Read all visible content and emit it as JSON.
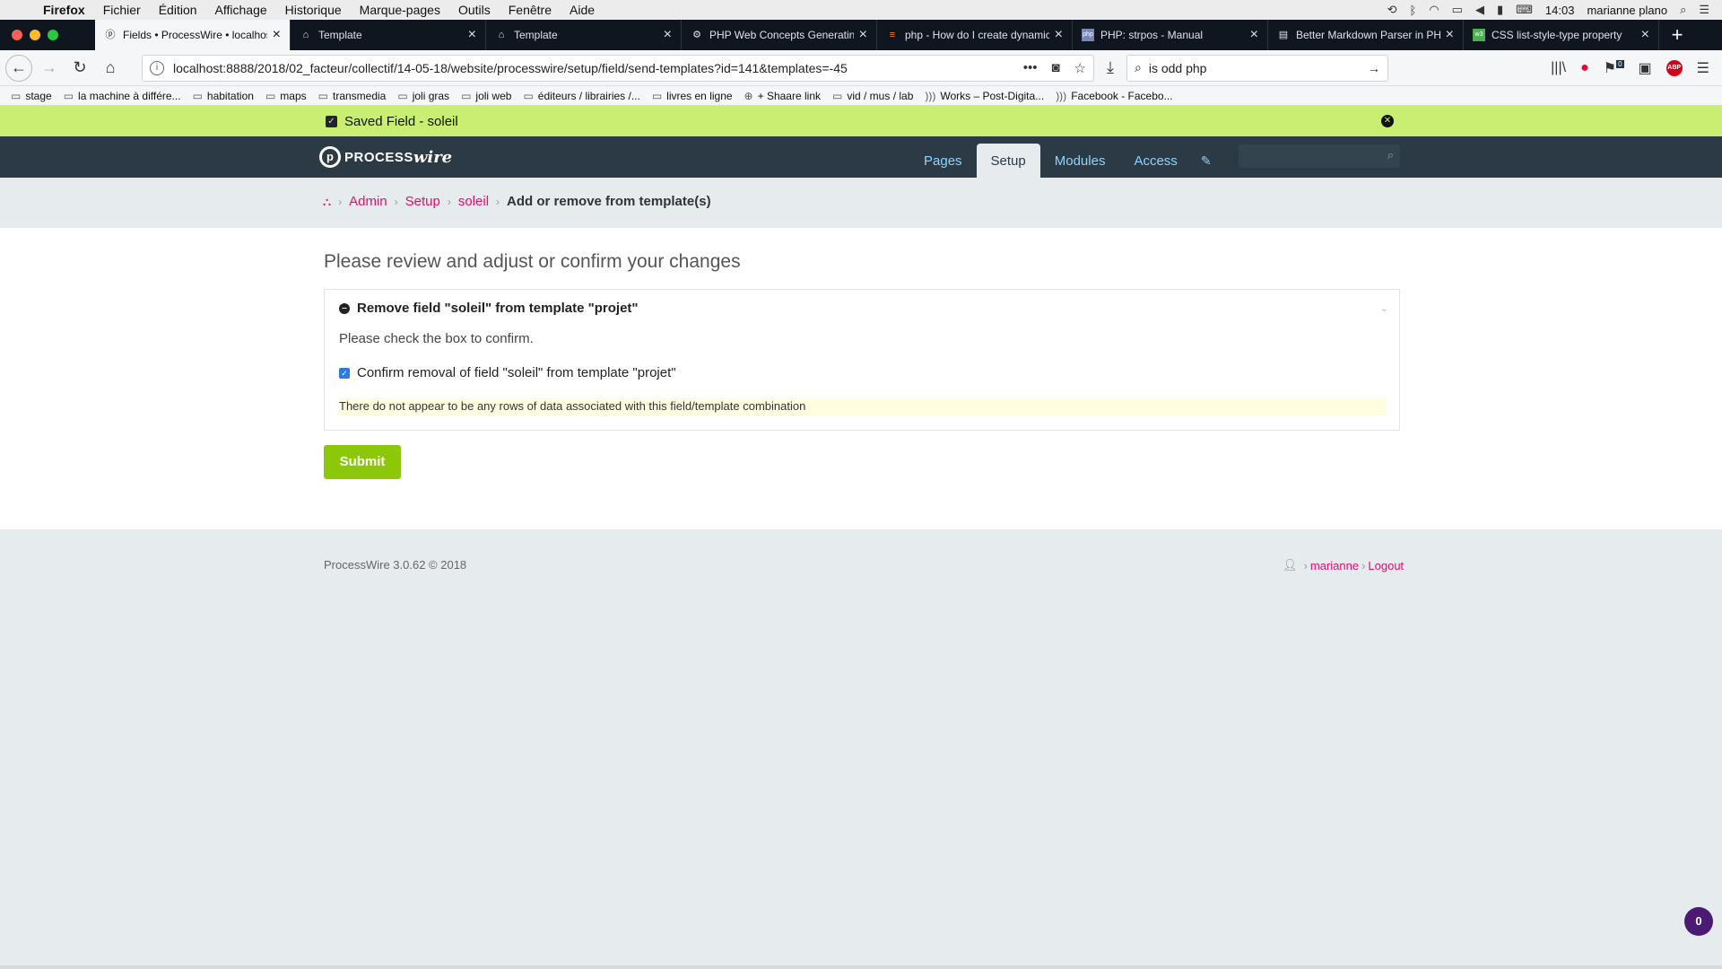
{
  "menubar": {
    "app": "Firefox",
    "items": [
      "Fichier",
      "Édition",
      "Affichage",
      "Historique",
      "Marque-pages",
      "Outils",
      "Fenêtre",
      "Aide"
    ],
    "time": "14:03",
    "user": "marianne plano"
  },
  "tabs": [
    {
      "label": "Fields • ProcessWire • localhost",
      "icon": "processwire-icon",
      "active": true
    },
    {
      "label": "Template",
      "icon": "home-icon",
      "active": false
    },
    {
      "label": "Template",
      "icon": "home-icon",
      "active": false
    },
    {
      "label": "PHP Web Concepts Generating",
      "icon": "gear-icon",
      "active": false
    },
    {
      "label": "php - How do I create dynamic",
      "icon": "stack-icon",
      "active": false
    },
    {
      "label": "PHP: strpos - Manual",
      "icon": "php-icon",
      "active": false
    },
    {
      "label": "Better Markdown Parser in PHP",
      "icon": "doc-icon",
      "active": false
    },
    {
      "label": "CSS list-style-type property",
      "icon": "w3-icon",
      "active": false
    }
  ],
  "navbar": {
    "url": "localhost:8888/2018/02_facteur/collectif/14-05-18/website/processwire/setup/field/send-templates?id=141&templates=-45",
    "search_value": "is odd php",
    "notif_count": "0"
  },
  "bookmarks": [
    "stage",
    "la machine à différe...",
    "habitation",
    "maps",
    "transmedia",
    "joli gras",
    "joli web",
    "éditeurs / librairies /...",
    "livres en ligne",
    "+ Shaare link",
    "vid / mus / lab",
    "Works – Post-Digita...",
    "Facebook - Facebo..."
  ],
  "notice": {
    "text": "Saved Field - soleil"
  },
  "pw": {
    "logo_a": "PROCESS",
    "logo_b": "wire",
    "nav": [
      "Pages",
      "Setup",
      "Modules",
      "Access"
    ]
  },
  "breadcrumb": {
    "items": [
      "Admin",
      "Setup",
      "soleil"
    ],
    "current": "Add or remove from template(s)"
  },
  "main": {
    "headline": "Please review and adjust or confirm your changes",
    "panel_title": "Remove field \"soleil\" from template \"projet\"",
    "help": "Please check the box to confirm.",
    "checkbox_label": "Confirm removal of field \"soleil\" from template \"projet\"",
    "checkbox_checked": true,
    "note": "There do not appear to be any rows of data associated with this field/template combination",
    "submit": "Submit"
  },
  "footer": {
    "left": "ProcessWire 3.0.62 © 2018",
    "user": "marianne",
    "logout": "Logout"
  },
  "badge": "0",
  "colors": {
    "accent": "#e20f6c",
    "header": "#2b3a44",
    "notice": "#c9ee72",
    "submit": "#8cc70a"
  }
}
